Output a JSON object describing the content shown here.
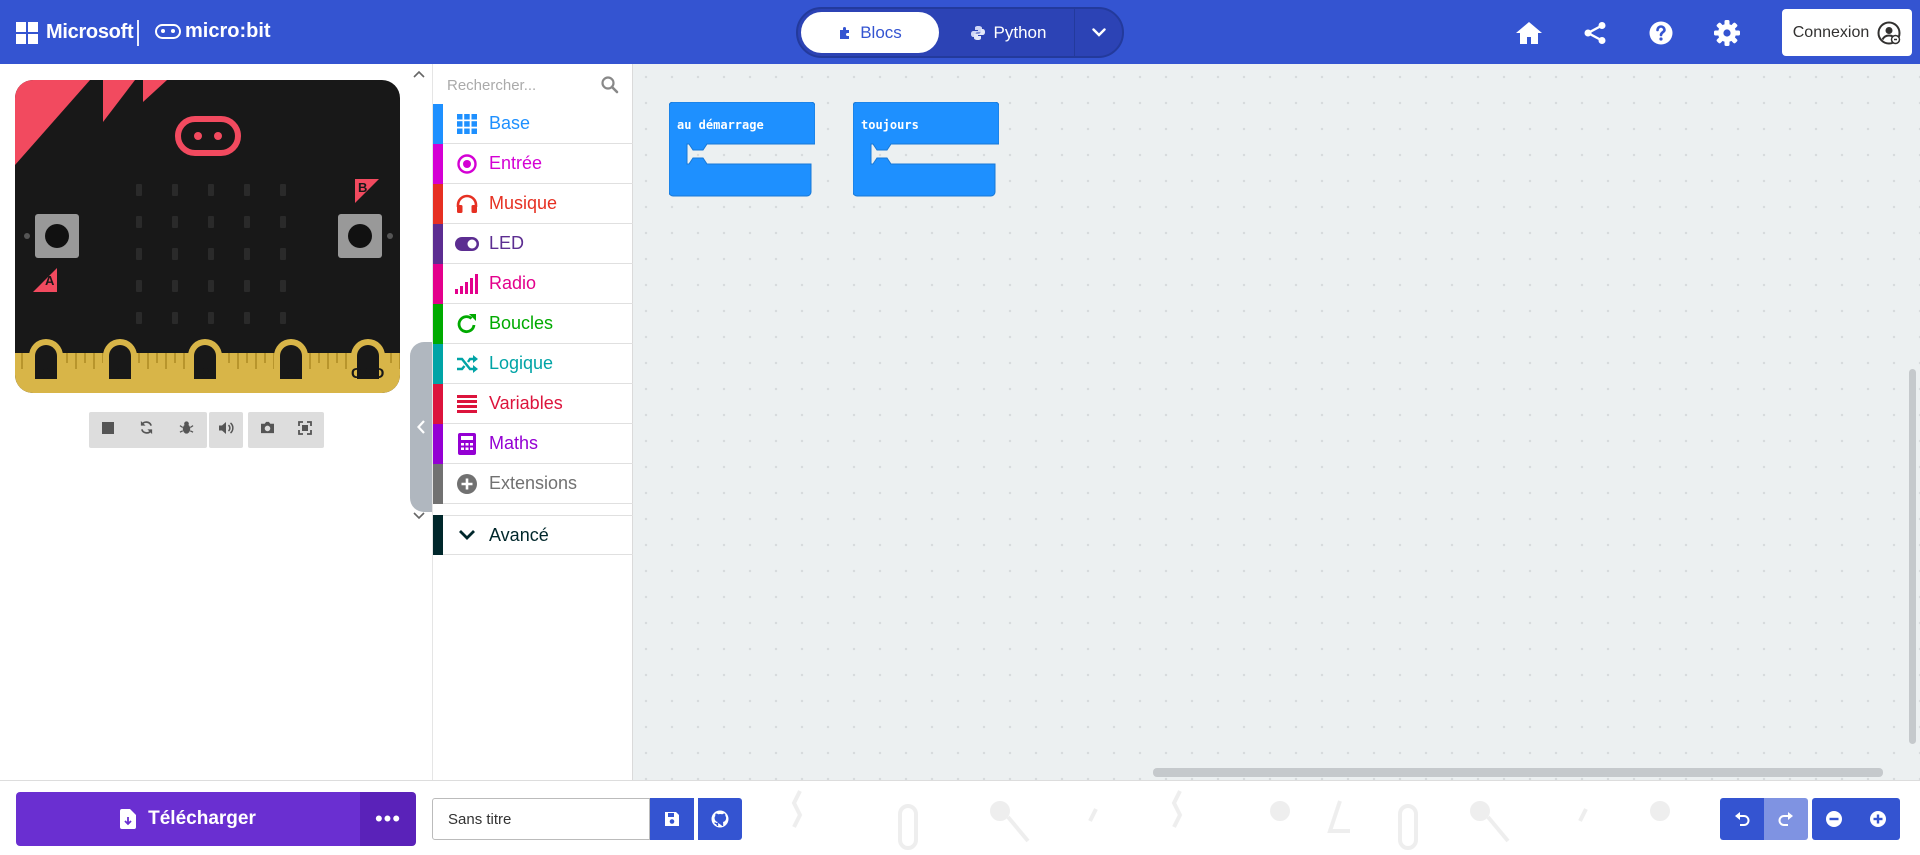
{
  "header": {
    "brand": "Microsoft",
    "product": "micro:bit",
    "editor_tabs": [
      {
        "label": "Blocs",
        "icon": "puzzle-icon",
        "active": true
      },
      {
        "label": "Python",
        "icon": "python-icon",
        "active": false
      }
    ],
    "icons": [
      "home-icon",
      "share-icon",
      "help-icon",
      "settings-icon"
    ],
    "signin_label": "Connexion",
    "accent": "#3454d1"
  },
  "simulator": {
    "pins": [
      "0",
      "1",
      "2",
      "3V",
      "GND"
    ],
    "button_a": "A",
    "button_b": "B",
    "controls": [
      "stop-icon",
      "restart-icon",
      "debug-icon",
      "sound-icon",
      "screenshot-icon",
      "fullscreen-icon"
    ]
  },
  "toolbox": {
    "search_placeholder": "Rechercher...",
    "categories": [
      {
        "label": "Base",
        "color": "#1e90ff",
        "icon": "grid-icon"
      },
      {
        "label": "Entrée",
        "color": "#d400d4",
        "icon": "input-icon"
      },
      {
        "label": "Musique",
        "color": "#e63022",
        "icon": "headphones-icon"
      },
      {
        "label": "LED",
        "color": "#5c2d91",
        "icon": "toggle-icon"
      },
      {
        "label": "Radio",
        "color": "#e3008c",
        "icon": "signal-icon"
      },
      {
        "label": "Boucles",
        "color": "#00aa00",
        "icon": "loop-icon"
      },
      {
        "label": "Logique",
        "color": "#00a4a6",
        "icon": "shuffle-icon"
      },
      {
        "label": "Variables",
        "color": "#dc143c",
        "icon": "list-icon"
      },
      {
        "label": "Maths",
        "color": "#9400d3",
        "icon": "calculator-icon"
      },
      {
        "label": "Extensions",
        "color": "#717171",
        "icon": "plus-circle-icon"
      }
    ],
    "advanced_label": "Avancé",
    "advanced_color": "#00272b"
  },
  "workspace": {
    "blocks": [
      {
        "label": "au démarrage",
        "color": "#1e90ff"
      },
      {
        "label": "toujours",
        "color": "#1e90ff"
      }
    ]
  },
  "footer": {
    "download_label": "Télécharger",
    "more_label": "•••",
    "project_name": "Sans titre",
    "download_color": "#6a2fd1"
  }
}
